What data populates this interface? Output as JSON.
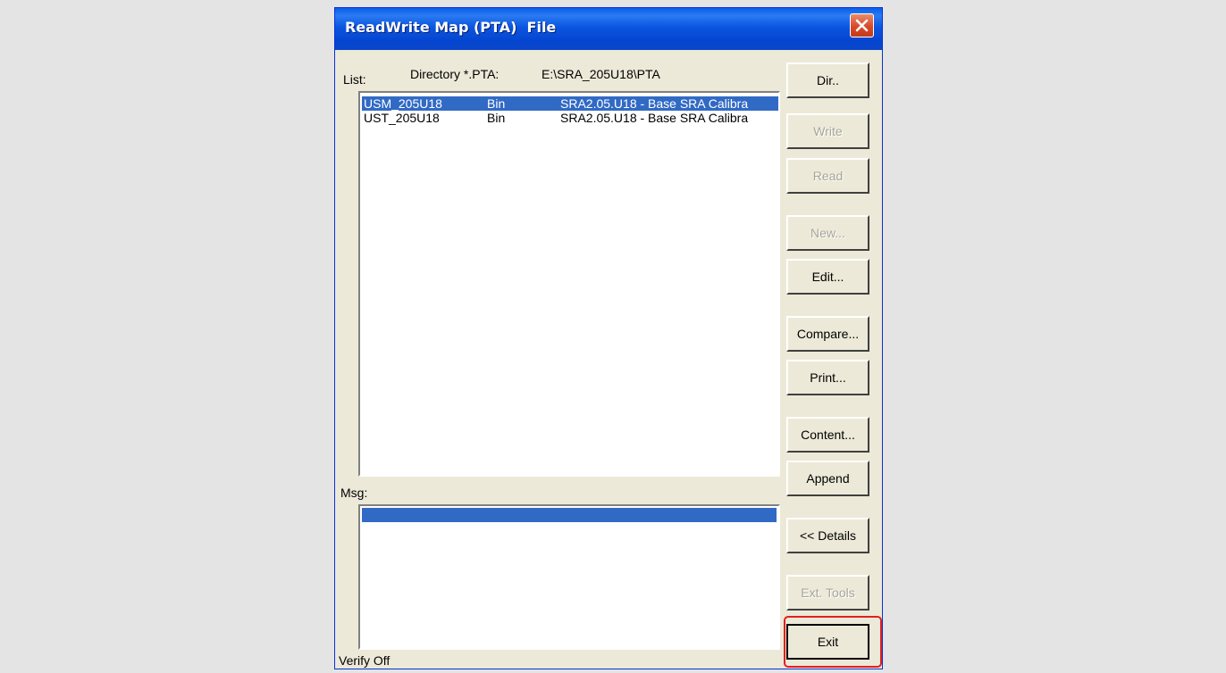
{
  "window": {
    "title": "ReadWrite Map (PTA)  File"
  },
  "header": {
    "list_label": "List:",
    "directory_label": "Directory *.PTA:",
    "directory_path": "E:\\SRA_205U18\\PTA"
  },
  "files": [
    {
      "name": "USM_205U18",
      "type": "Bin",
      "description": "SRA2.05.U18 - Base SRA Calibra",
      "selected": true
    },
    {
      "name": "UST_205U18",
      "type": "Bin",
      "description": "SRA2.05.U18 - Base SRA Calibra",
      "selected": false
    }
  ],
  "msg_label": "Msg:",
  "status": "Verify Off",
  "buttons": {
    "dir": "Dir..",
    "write": "Write",
    "read": "Read",
    "new": "New...",
    "edit": "Edit...",
    "compare": "Compare...",
    "print": "Print...",
    "content": "Content...",
    "append": "Append",
    "details": "<< Details",
    "ext_tools": "Ext. Tools",
    "exit": "Exit"
  },
  "colors": {
    "title_bar": "#0a4fd6",
    "selection": "#316ac5",
    "close_button": "#d9492b",
    "highlight": "#e02020"
  }
}
